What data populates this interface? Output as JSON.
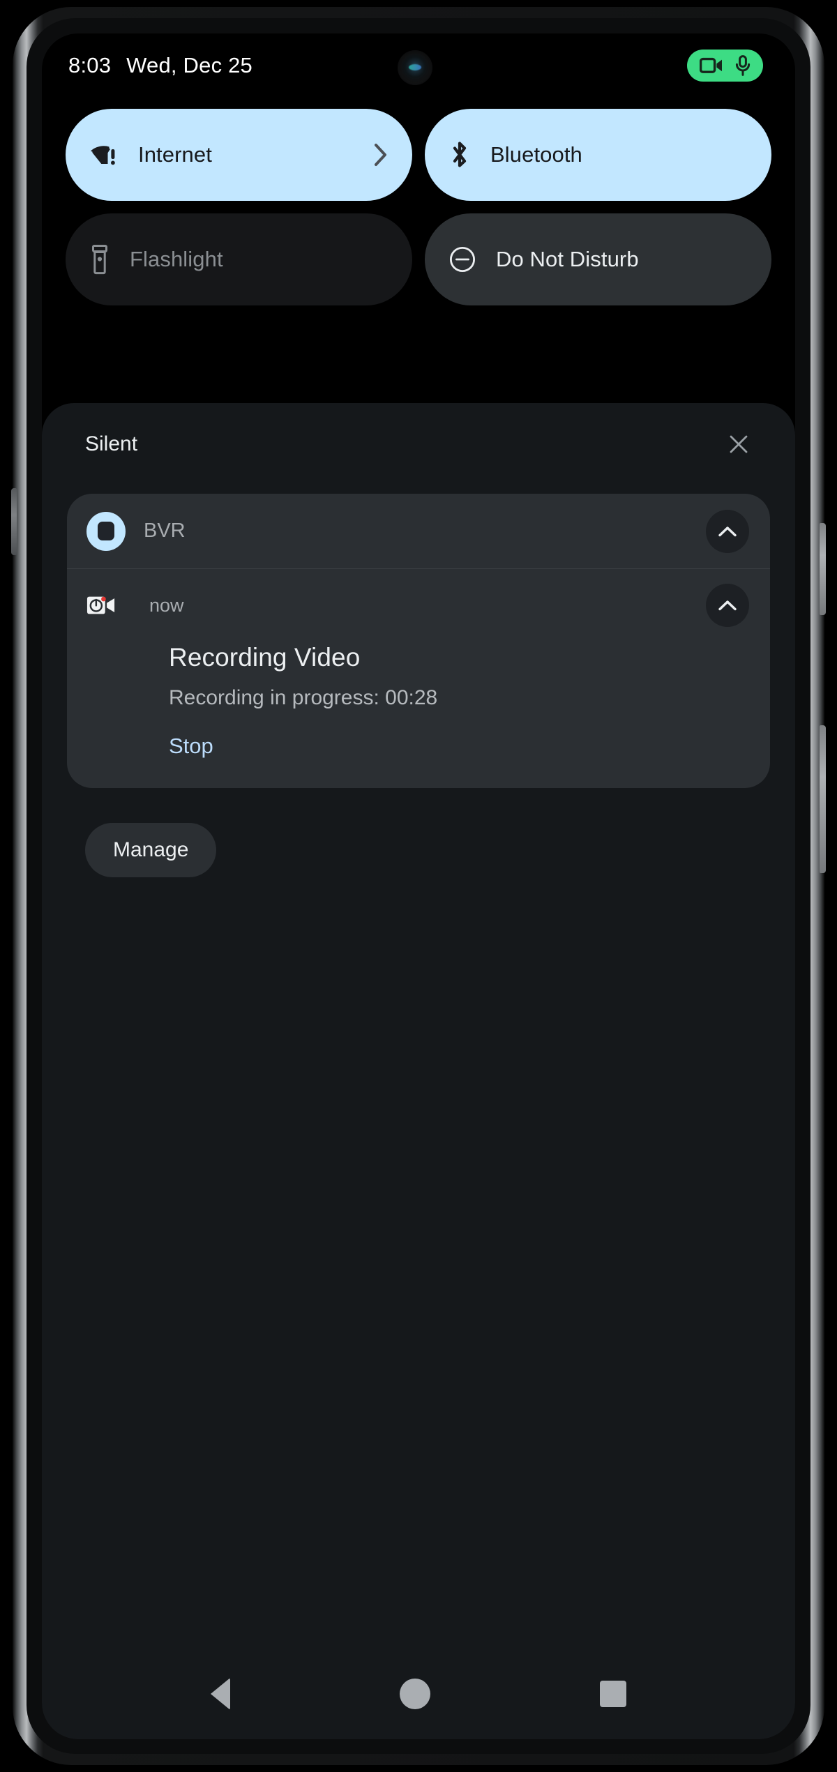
{
  "status_bar": {
    "time": "8:03",
    "date": "Wed, Dec 25",
    "privacy_indicator": {
      "camera_icon": "video-camera-icon",
      "mic_icon": "microphone-icon",
      "color": "#3DDC84"
    },
    "camera_punchhole": "front-camera-punchhole"
  },
  "quick_settings": {
    "tiles": [
      {
        "label": "Internet",
        "icon": "wifi-no-internet-icon",
        "state": "active",
        "has_chevron": true
      },
      {
        "label": "Bluetooth",
        "icon": "bluetooth-icon",
        "state": "active",
        "has_chevron": false
      },
      {
        "label": "Flashlight",
        "icon": "flashlight-icon",
        "state": "inactive-dim",
        "has_chevron": false
      },
      {
        "label": "Do Not Disturb",
        "icon": "do-not-disturb-icon",
        "state": "inactive-lit",
        "has_chevron": false
      }
    ],
    "active_color": "#C2E7FF",
    "inactive_dim_color": "#161719",
    "inactive_lit_color": "#2D3134"
  },
  "shade": {
    "section_title": "Silent",
    "clear_button_icon": "close-icon",
    "group": {
      "app_name": "BVR",
      "app_icon": "bvr-app-icon",
      "collapse_icon": "chevron-up-icon",
      "notification": {
        "small_icon": "recording-video-icon",
        "timestamp": "now",
        "expand_icon": "chevron-up-icon",
        "title": "Recording Video",
        "text": "Recording in progress: 00:28",
        "action_label": "Stop",
        "action_color": "#BCDCFB"
      }
    },
    "manage_label": "Manage",
    "panel_color": "#15181B",
    "notification_color": "#2B2F33"
  },
  "nav_bar": {
    "back": "back-button",
    "home": "home-button",
    "recents": "recents-button",
    "color": "#AAAEB2"
  }
}
